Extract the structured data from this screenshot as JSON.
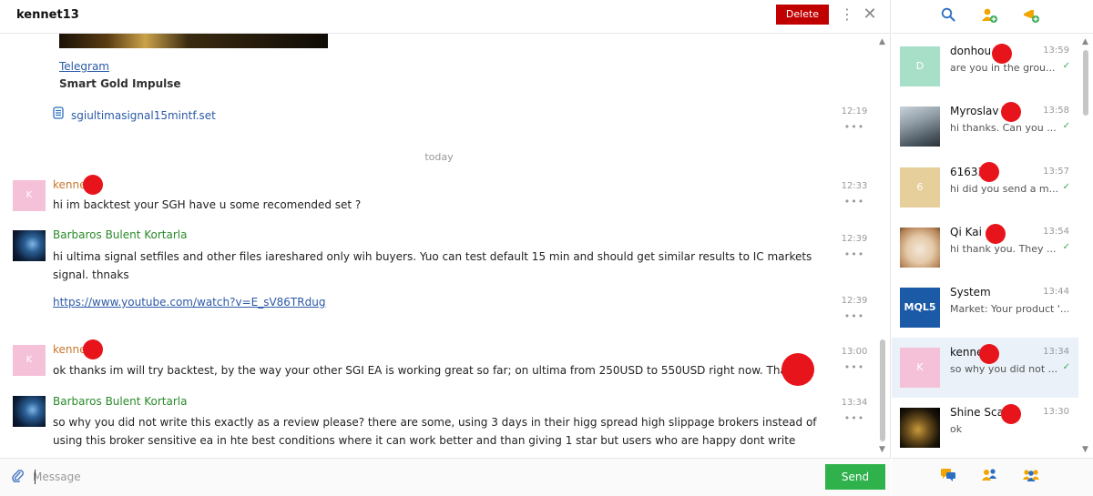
{
  "header": {
    "title": "kennet13",
    "delete_label": "Delete",
    "kebab_glyph": "⋮",
    "close_glyph": "✕"
  },
  "messages": {
    "telegram_link": "Telegram",
    "telegram_name": "Smart Gold Impulse",
    "file_name": "sgiultimasignal15mintf.set",
    "file_time": "12:19",
    "today_label": "today",
    "more_glyph": "•••",
    "items": [
      {
        "sender": "kenne",
        "text": "hi im backtest your SGH have u some recomended set ?",
        "time": "12:33"
      },
      {
        "sender": "Barbaros Bulent Kortarla",
        "text": "hi ultima signal setfiles and other files iareshared only wih buyers. Yuo can test default 15 min and should get similar results to IC markets signal. thnaks",
        "time": "12:39"
      },
      {
        "link": "https://www.youtube.com/watch?v=E_sV86TRdug",
        "time": "12:39"
      },
      {
        "sender": "kenne",
        "text": "ok thanks im will try backtest, by the way your other SGI EA is working great so far; on ultima from 250USD to 550USD right now. Thanks!",
        "time": "13:00"
      },
      {
        "sender": "Barbaros Bulent Kortarla",
        "text": "so why you did not write this exactly as a review please? there are some, using 3 days in their higg spread high slippage brokers instead of using this broker sensitive ea in hte best conditions where it can work better and than giving 1 star but users who are happy dont write",
        "time": "13:34"
      }
    ],
    "avatar_letter": "K"
  },
  "composer": {
    "placeholder": "Message",
    "send_label": "Send"
  },
  "sidebar": {
    "chats": [
      {
        "name": "donhou",
        "time": "13:59",
        "preview": "are you in the grou...",
        "avatar_letter": "D",
        "avatar_color": "#a8dfc8"
      },
      {
        "name": "Myroslav T...",
        "time": "13:58",
        "preview": "hi thanks. Can you ..."
      },
      {
        "name": "61633",
        "time": "13:57",
        "preview": "hi did you send a m...",
        "avatar_letter": "6",
        "avatar_color": "#e6cf9a"
      },
      {
        "name": "Qi Kai",
        "time": "13:54",
        "preview": "hi thank you. They ..."
      },
      {
        "name": "System",
        "time": "13:44",
        "preview": "Market: Your product '...",
        "avatar_text": "MQL5"
      },
      {
        "name": "kenne",
        "time": "13:34",
        "preview": "so why you did not ...",
        "avatar_letter": "K",
        "avatar_color": "#f5c1d8"
      },
      {
        "name": "Shine Sca",
        "time": "13:30",
        "preview": "ok"
      }
    ],
    "check_glyph": "✓"
  },
  "colors": {
    "accent_blue": "#2b5aa6",
    "delete_red": "#c00000",
    "send_green": "#2fb24c",
    "sender_orange": "#c8762c",
    "sender_green": "#2a8a2a",
    "icon_orange": "#f0a500",
    "icon_blue": "#2b6fc2",
    "redaction_red": "#e8141b"
  },
  "icons": {
    "top": [
      "search-icon",
      "add-contact-icon",
      "add-channel-icon"
    ],
    "bottom": [
      "chats-icon",
      "contacts-icon",
      "groups-icon"
    ],
    "attach": "paperclip-icon"
  }
}
